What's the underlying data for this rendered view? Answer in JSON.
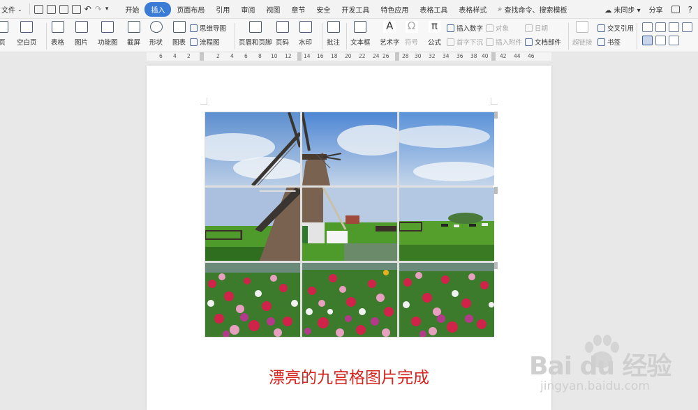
{
  "menubar": {
    "file_label": "文件",
    "tabs": [
      "开始",
      "插入",
      "页面布局",
      "引用",
      "审阅",
      "视图",
      "章节",
      "安全",
      "开发工具",
      "特色应用",
      "表格工具",
      "表格样式"
    ],
    "active_tab": "插入",
    "search_label": "查找命令、搜索模板",
    "sync_label": "未同步",
    "share_label": "分享",
    "help_label": "?"
  },
  "toolbar": {
    "page_label": "页",
    "blank_page_label": "空白页",
    "table_label": "表格",
    "picture_label": "图片",
    "function_chart_label": "功能图",
    "screenshot_label": "截屏",
    "shape_label": "形状",
    "chart_label": "图表",
    "mindmap_label": "思维导图",
    "flowchart_label": "流程图",
    "header_footer_label": "页眉和页脚",
    "page_number_label": "页码",
    "watermark_label": "水印",
    "comment_label": "批注",
    "textbox_label": "文本框",
    "wordart_label": "艺术字",
    "symbol_label": "符号",
    "formula_label": "公式",
    "insert_number_label": "插入数字",
    "object_label": "对象",
    "date_label": "日期",
    "first_sink_label": "首字下沉",
    "insert_attachment_label": "插入附件",
    "doc_parts_label": "文档部件",
    "hyperlink_label": "超链接",
    "cross_ref_label": "交叉引用",
    "bookmark_label": "书签"
  },
  "ruler": {
    "labels": [
      "6",
      "4",
      "2",
      "2",
      "4",
      "6",
      "8",
      "10",
      "12",
      "14",
      "16",
      "18",
      "20",
      "22",
      "24",
      "26",
      "28",
      "30",
      "32",
      "34",
      "36",
      "38",
      "40",
      "42",
      "44",
      "46"
    ]
  },
  "document": {
    "caption": "漂亮的九宫格图片完成"
  },
  "watermark": {
    "logo_text": "Bai du 经验",
    "url": "jingyan.baidu.com"
  },
  "colors": {
    "accent": "#3a7bd5",
    "caption": "#d6251f",
    "sky": "#6e9cd6",
    "grass": "#4e9a2a"
  }
}
